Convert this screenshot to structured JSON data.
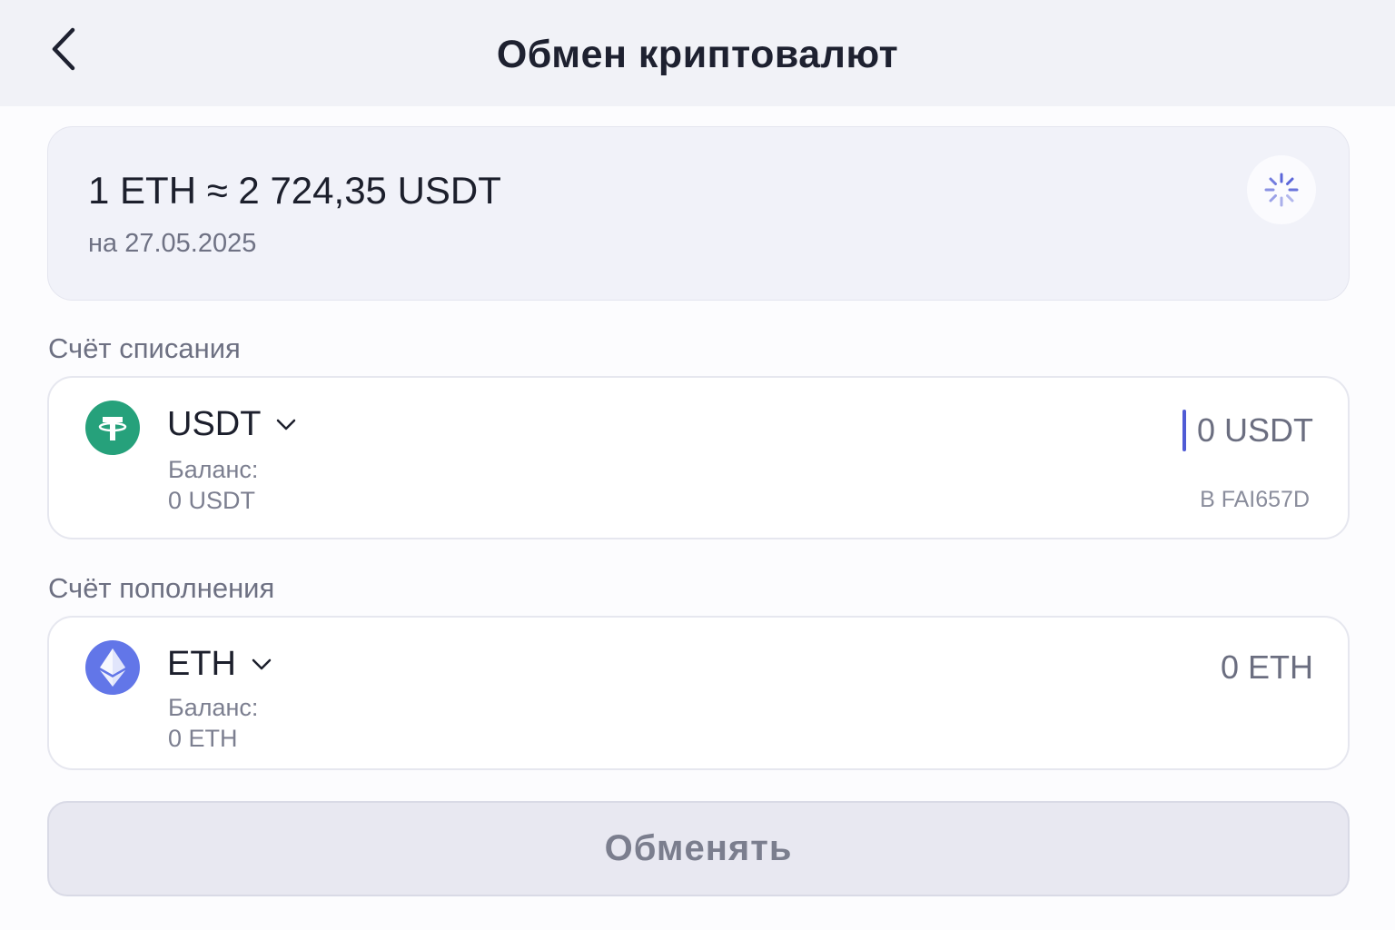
{
  "header": {
    "title": "Обмен криптовалют"
  },
  "rate": {
    "value": "1 ETH ≈ 2 724,35 USDT",
    "date": "на 27.05.2025"
  },
  "from_section": {
    "label": "Счёт списания",
    "currency": "USDT",
    "balance_label": "Баланс:",
    "balance_value": "0 USDT",
    "amount": "0 USDT",
    "account_id": "B FAI657D",
    "icon": "tether-icon",
    "icon_color": "#26a17b"
  },
  "to_section": {
    "label": "Счёт пополнения",
    "currency": "ETH",
    "balance_label": "Баланс:",
    "balance_value": "0 ETH",
    "amount": "0 ETH",
    "icon": "ethereum-icon",
    "icon_color": "#6276e8"
  },
  "actions": {
    "exchange_label": "Обменять"
  },
  "colors": {
    "accent": "#4f5bd5",
    "disabled_button": "#e8e8f1"
  }
}
